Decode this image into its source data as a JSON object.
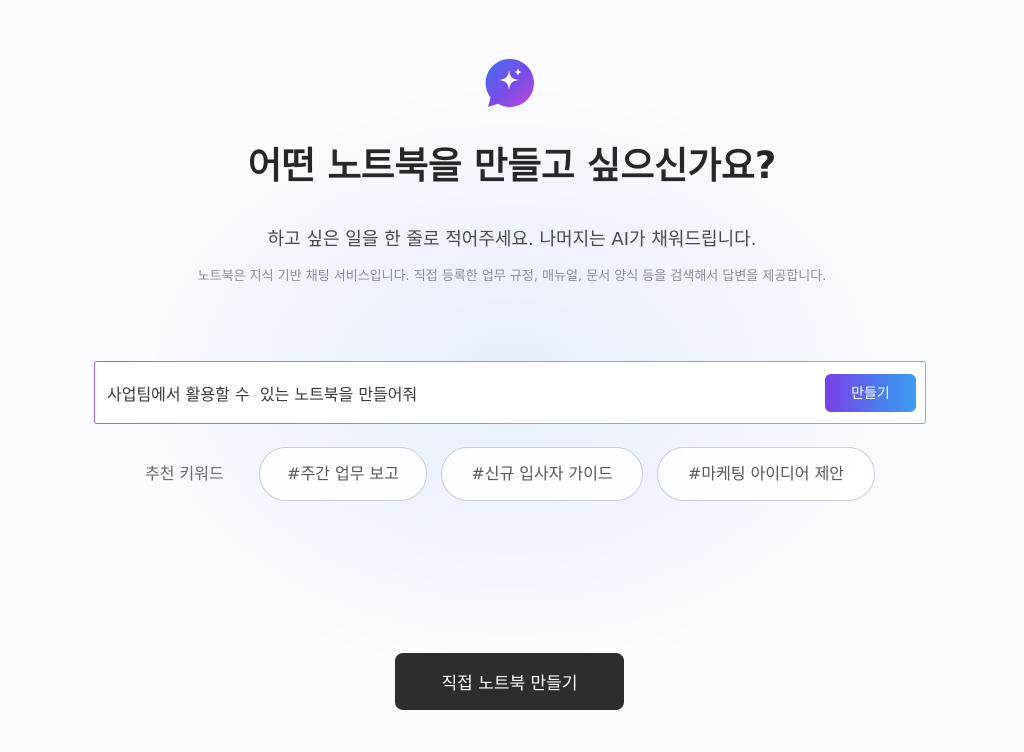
{
  "header": {
    "logo_icon": "sparkle-chat-bubble-icon",
    "title": "어떤 노트북을 만들고 싶으신가요?",
    "subtitle": "하고 싶은 일을 한 줄로 적어주세요. 나머지는 AI가 채워드립니다.",
    "description": "노트북은 지식 기반 채팅 서비스입니다. 직접 등록한 업무 규정, 매뉴얼, 문서 양식 등을 검색해서 답변을 제공합니다."
  },
  "prompt": {
    "value": "사업팀에서 활용할 수  있는 노트북을 만들어줘",
    "submit_label": "만들기"
  },
  "keywords": {
    "label": "추천 키워드",
    "items": [
      "#주간 업무 보고",
      "#신규 입사자 가이드",
      "#마케팅 아이디어 제안"
    ]
  },
  "footer": {
    "manual_create_label": "직접 노트북 만들기"
  },
  "colors": {
    "accent_start": "#7b3fe4",
    "accent_end": "#3b9df2",
    "dark_button": "#2d2d2f"
  }
}
